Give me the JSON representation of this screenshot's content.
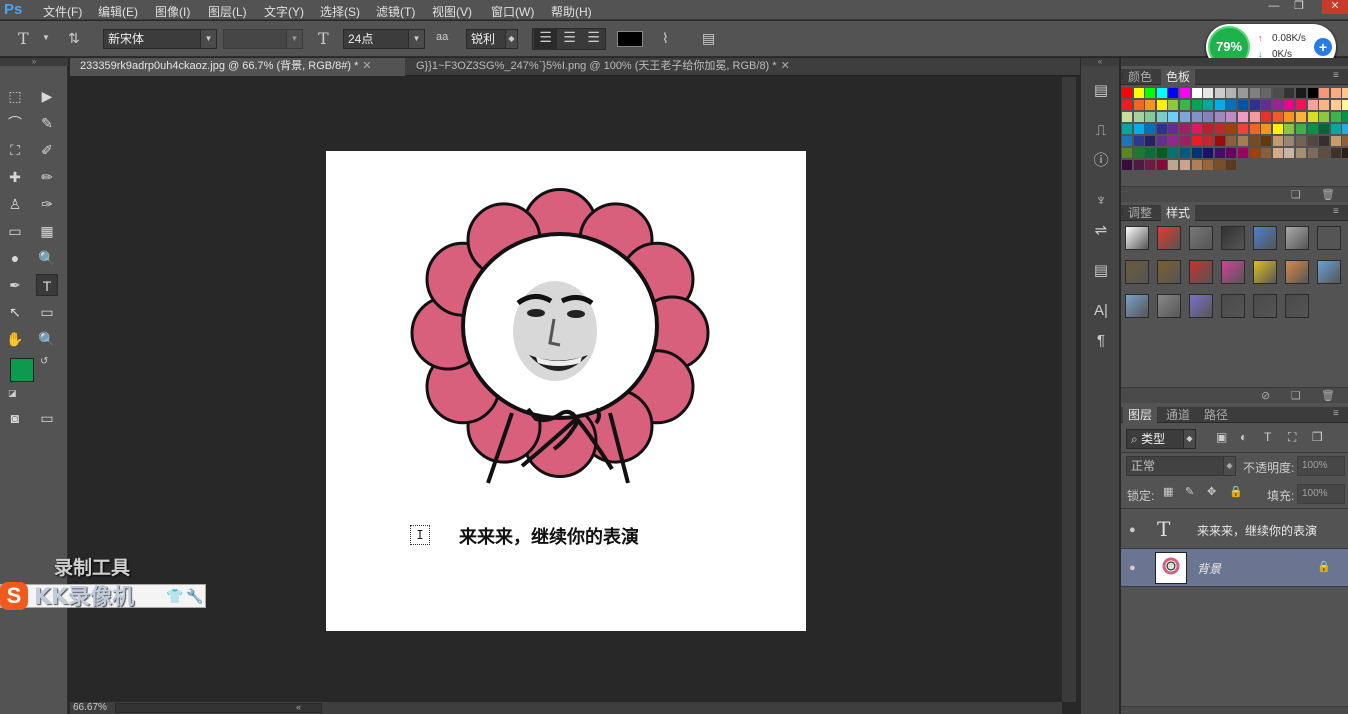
{
  "app": {
    "logo": "Ps"
  },
  "menu": [
    "文件(F)",
    "编辑(E)",
    "图像(I)",
    "图层(L)",
    "文字(Y)",
    "选择(S)",
    "滤镜(T)",
    "视图(V)",
    "窗口(W)",
    "帮助(H)"
  ],
  "window_controls": {
    "minimize": "—",
    "restore": "❐",
    "close": "✕"
  },
  "options": {
    "tool_glyph": "T",
    "font_family": "新宋体",
    "font_style": "",
    "font_size": "24点",
    "size_icon": "T",
    "aa_icon": "aa",
    "antialias": "锐利",
    "color": "#000000"
  },
  "netmon": {
    "percent": "79%",
    "up": "0.08K/s",
    "down": "0K/s",
    "plus": "+"
  },
  "tabs": [
    {
      "label": "233359rk9adrp0uh4ckaoz.jpg @ 66.7% (背景, RGB/8#) *",
      "close": "✕",
      "active": true
    },
    {
      "label": "G}}1~F3OZ3SG%_247%`}5%I.png @ 100% (天王老子给你加冕, RGB/8) *",
      "close": "✕",
      "active": false
    }
  ],
  "tools": [
    "⬚",
    "▶",
    "⌒",
    "✎",
    "⛶",
    "✐",
    "✚",
    "✏",
    "♙",
    "✑",
    "▭",
    "▦",
    "●",
    "🔍",
    "✒",
    "T",
    "↖",
    "▭",
    "✋",
    "🔍"
  ],
  "colors": {
    "foreground": "#0b9a4e",
    "background": "#ffffff",
    "accent": "#4aa3f0"
  },
  "document": {
    "caption": "来来来，继续你的表演",
    "cursor": "I",
    "petal_color": "#d9607c"
  },
  "status": {
    "zoom": "66.67%"
  },
  "dock_icons": [
    "▤",
    "⎍",
    "ⓘ",
    "♆",
    "⇌",
    "▤",
    "A|",
    "¶"
  ],
  "panels": {
    "swatches_tabs": [
      "颜色",
      "色板"
    ],
    "styles_tabs": [
      "调整",
      "样式"
    ],
    "layers_tabs": [
      "图层",
      "通道",
      "路径"
    ],
    "filter_kind": "类型",
    "filter_icons": [
      "▣",
      "◐",
      "T",
      "⛶",
      "❒"
    ],
    "blend_mode": "正常",
    "opacity_label": "不透明度:",
    "opacity_value": "100%",
    "lock_label": "锁定:",
    "lock_icons": [
      "▦",
      "✎",
      "✥",
      "🔒"
    ],
    "fill_label": "填充:",
    "fill_value": "100%",
    "layers": [
      {
        "name": "来来来，继续你的表演",
        "type": "text",
        "thumb": "T",
        "eye": "●"
      },
      {
        "name": "背景",
        "type": "image",
        "eye": "●",
        "lock": "🔒",
        "selected": true
      }
    ]
  },
  "watermark": {
    "title": "录制工具",
    "brand": "KK录像机",
    "logo": "S"
  }
}
